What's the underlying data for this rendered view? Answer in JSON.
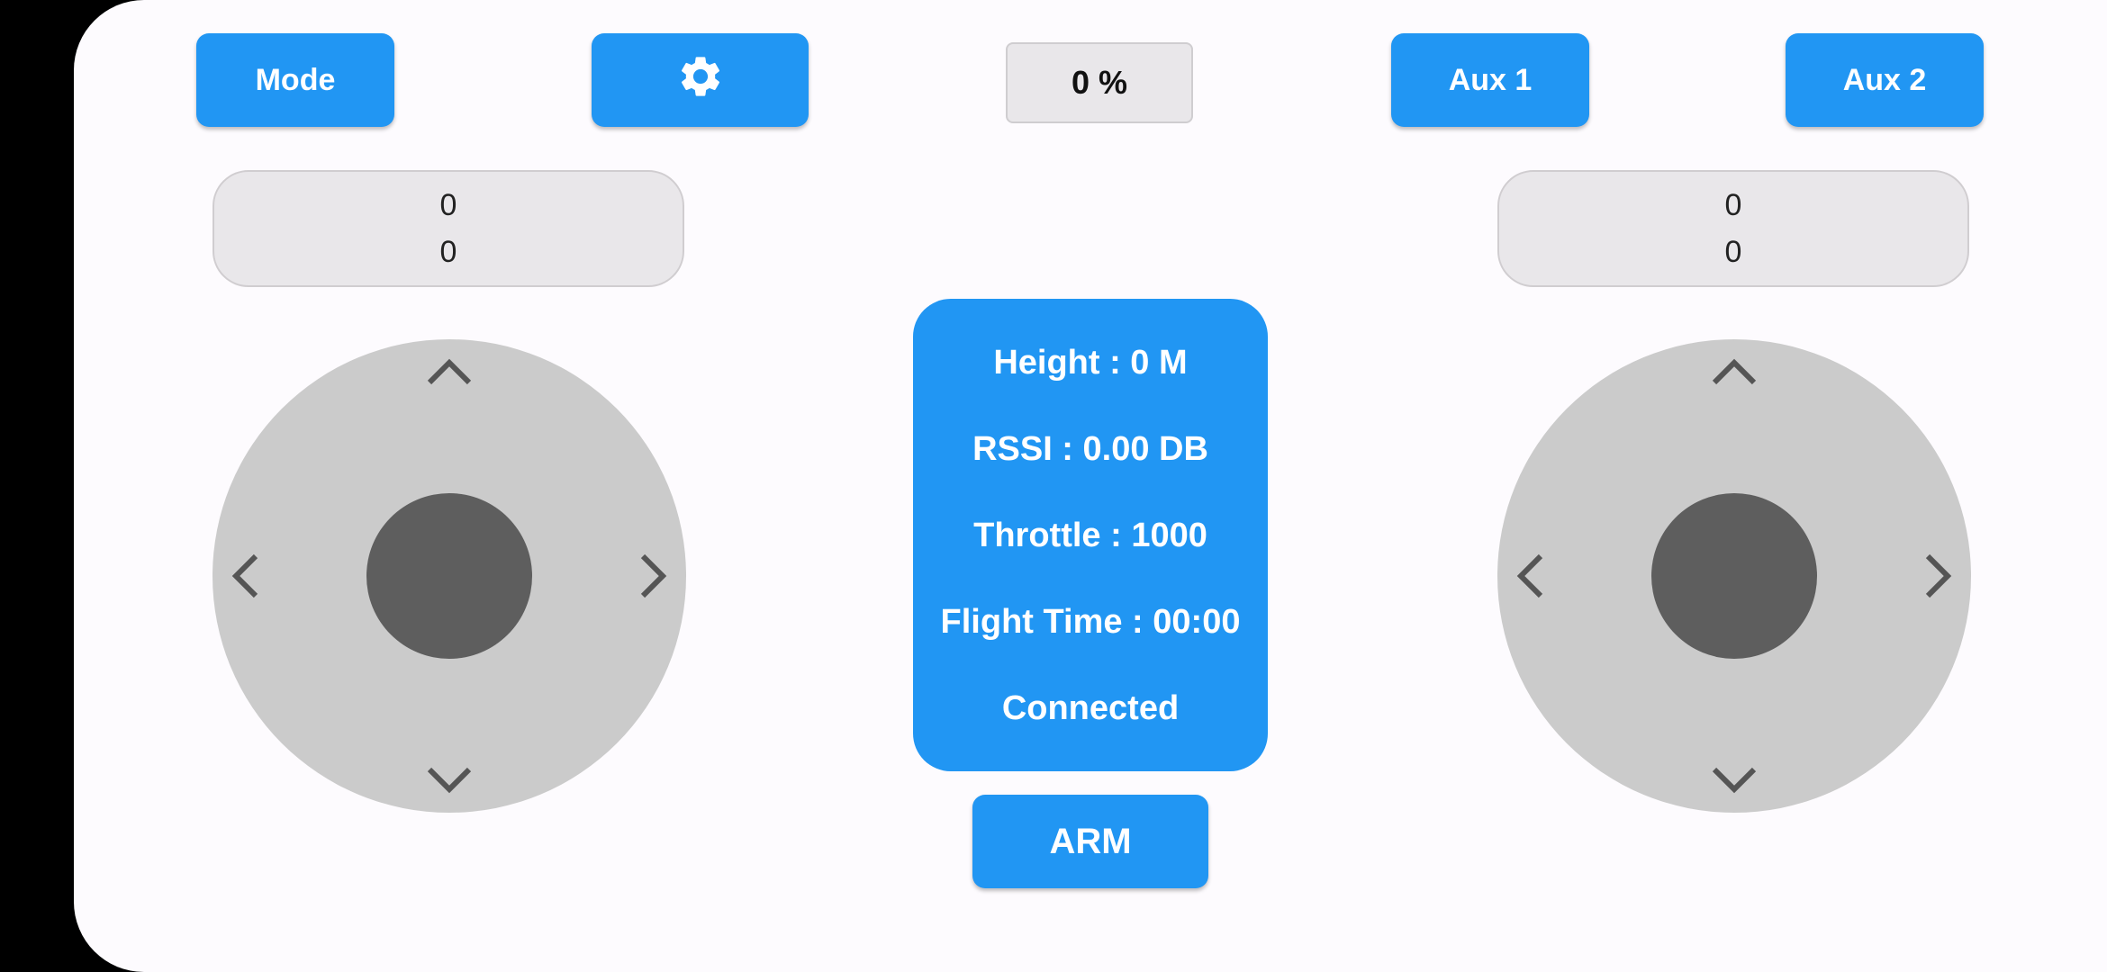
{
  "top_bar": {
    "mode_label": "Mode",
    "settings_icon": "gear-icon",
    "battery_text": "0 %",
    "aux1_label": "Aux 1",
    "aux2_label": "Aux 2"
  },
  "left_stick": {
    "readout_line1": "0",
    "readout_line2": "0"
  },
  "right_stick": {
    "readout_line1": "0",
    "readout_line2": "0"
  },
  "status": {
    "height": "Height : 0 M",
    "rssi": "RSSI : 0.00 DB",
    "throttle": "Throttle : 1000",
    "flight_time": "Flight Time : 00:00",
    "connection": "Connected"
  },
  "arm_label": "ARM",
  "colors": {
    "accent": "#2196f3",
    "joystick_base": "#cbcbcb",
    "joystick_knob": "#5e5e5e"
  }
}
